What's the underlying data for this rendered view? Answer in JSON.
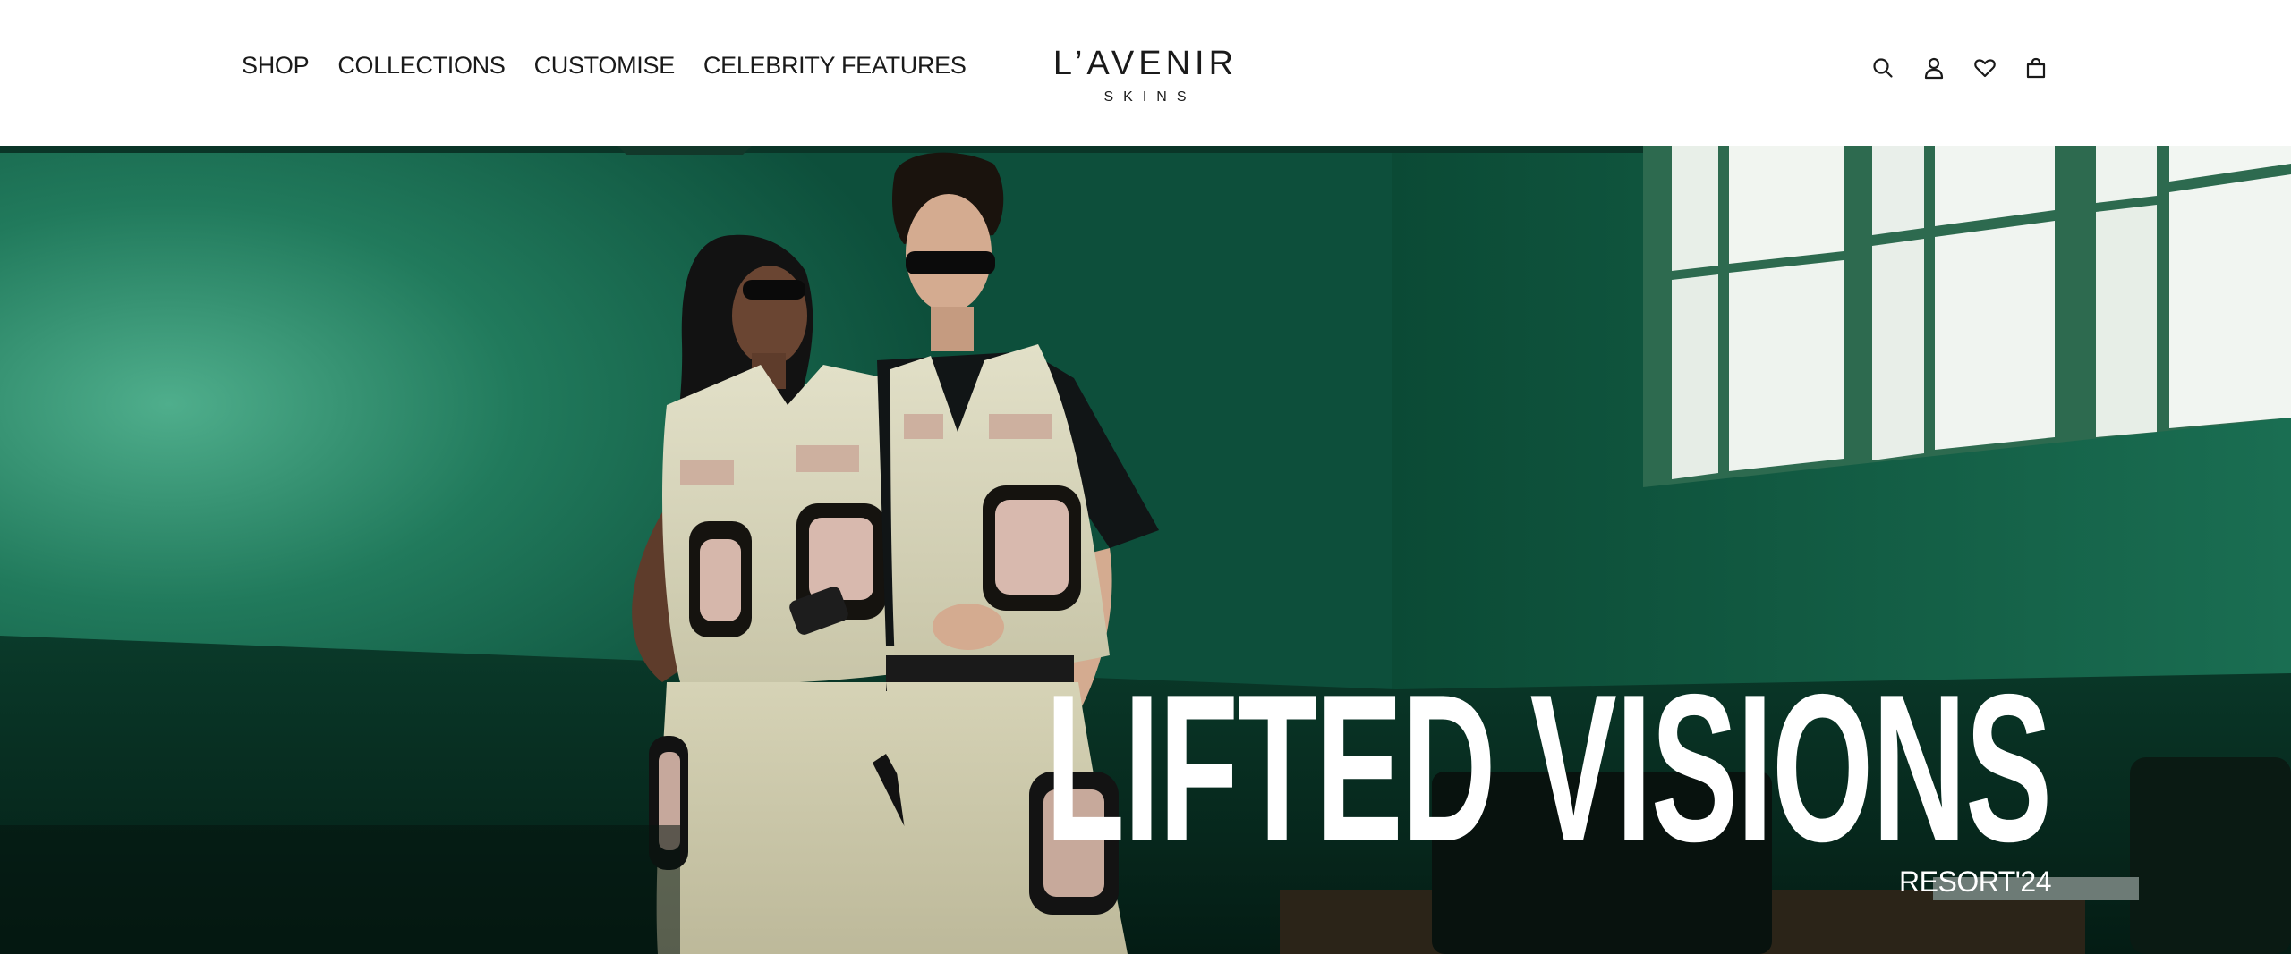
{
  "nav": {
    "items": [
      {
        "label": "SHOP"
      },
      {
        "label": "COLLECTIONS"
      },
      {
        "label": "CUSTOMISE"
      },
      {
        "label": "CELEBRITY FEATURES"
      }
    ]
  },
  "logo": {
    "main": "L’AVENIR",
    "sub": "SKINS"
  },
  "header_icons": [
    "search-icon",
    "account-icon",
    "wishlist-icon",
    "cart-icon"
  ],
  "hero": {
    "title": "LIFTED VISIONS",
    "subtitle": "RESORT'24",
    "colors": {
      "wall": "#1f7a5c",
      "wall_dark": "#0b3f2e",
      "text": "#ffffff"
    }
  }
}
